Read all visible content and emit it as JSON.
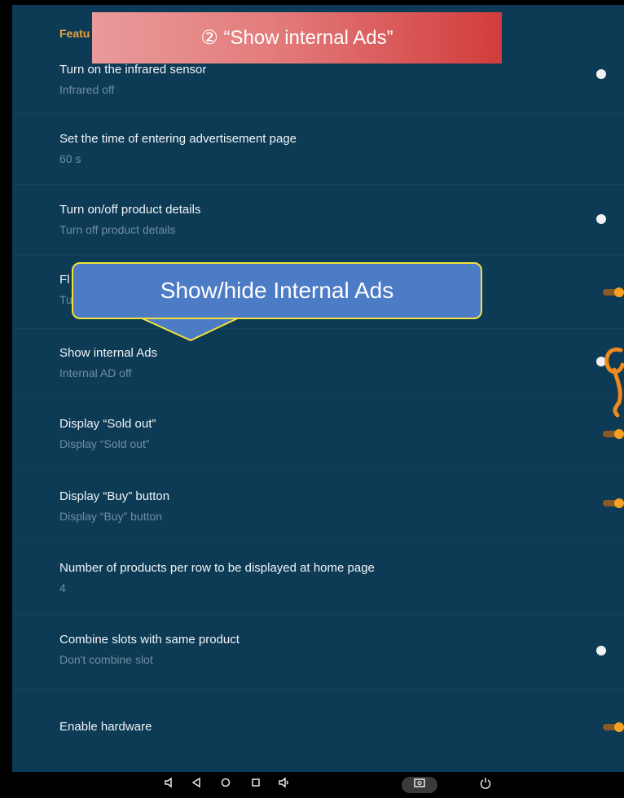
{
  "settings": {
    "section_header": "Featu",
    "items": [
      {
        "title": "Turn on the infrared sensor",
        "subtitle": "Infrared off",
        "toggle": "off"
      },
      {
        "title": "Set the time of entering advertisement page",
        "subtitle": "60 s"
      },
      {
        "title": "Turn on/off product details",
        "subtitle": "Turn off product details",
        "toggle": "off"
      },
      {
        "title": "Fl",
        "subtitle": "Tu",
        "toggle": "on"
      },
      {
        "title": "Show internal Ads",
        "subtitle": "Internal AD off",
        "toggle": "off"
      },
      {
        "title": "Display “Sold out”",
        "subtitle": "Display “Sold out”",
        "toggle": "on"
      },
      {
        "title": "Display “Buy” button",
        "subtitle": "Display “Buy” button",
        "toggle": "on"
      },
      {
        "title": "Number of products per row to be displayed at home page",
        "subtitle": "4"
      },
      {
        "title": "Combine slots with same product",
        "subtitle": "Don't combine slot",
        "toggle": "off"
      },
      {
        "title": "Enable hardware",
        "toggle": "on"
      }
    ]
  },
  "annotations": {
    "banner": "② “Show internal Ads”",
    "callout": "Show/hide Internal Ads"
  },
  "navbar": {
    "icons": [
      "speaker-low-icon",
      "back-icon",
      "home-icon",
      "recents-icon",
      "speaker-high-icon",
      "screenshot-icon",
      "power-icon"
    ]
  },
  "colors": {
    "background": "#0d3a55",
    "accent": "#f7a021",
    "banner": "#d23c3c",
    "callout": "#4d7cc6",
    "callout_border": "#f1e23a"
  }
}
